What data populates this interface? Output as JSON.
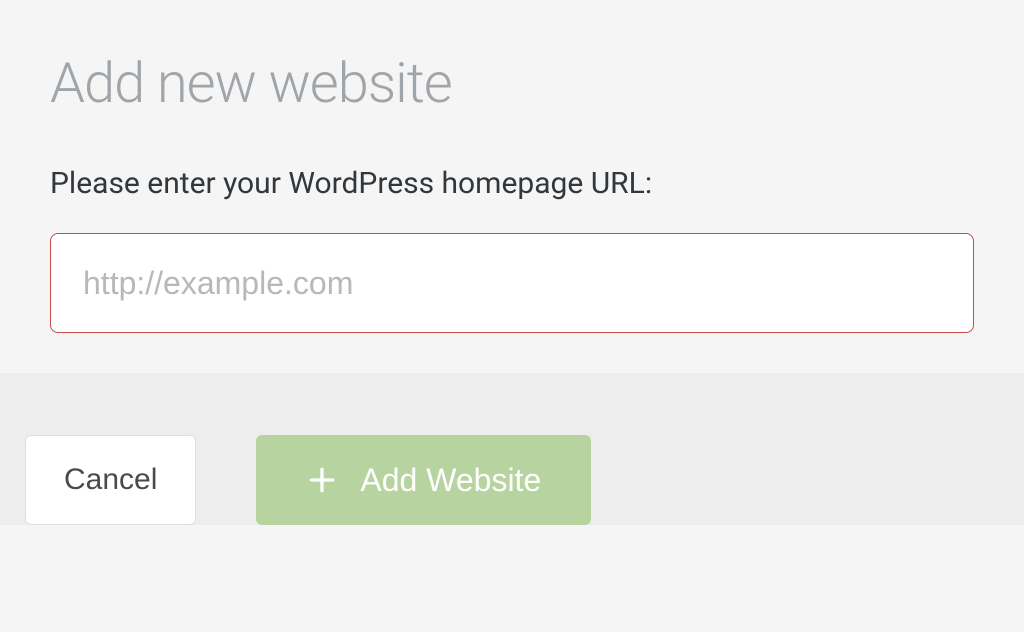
{
  "header": {
    "title": "Add new website"
  },
  "form": {
    "label": "Please enter your WordPress homepage URL:",
    "url_input": {
      "placeholder": "http://example.com",
      "value": ""
    }
  },
  "footer": {
    "cancel_label": "Cancel",
    "add_label": "Add Website"
  },
  "colors": {
    "title": "#a0a5aa",
    "input_border": "#c94c4c",
    "primary_button": "#b7d4a0",
    "footer_bg": "#ededed"
  }
}
